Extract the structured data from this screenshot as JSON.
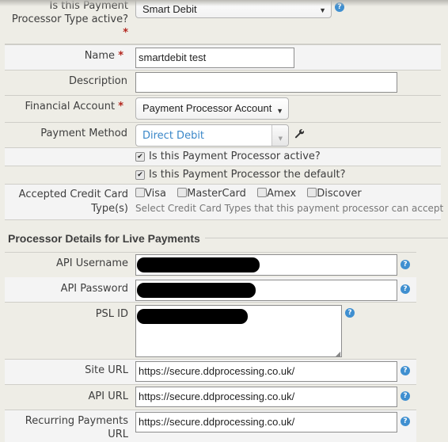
{
  "form": {
    "processor_type": {
      "label": "Is this Payment Processor Type active?",
      "label_line1": "Is this Payment",
      "label_line2": "Processor Type active?",
      "required": "*",
      "value": "Smart Debit",
      "arrow": "▼",
      "help": "?"
    },
    "name": {
      "label": "Name",
      "required": "*",
      "value": "smartdebit test"
    },
    "description": {
      "label": "Description",
      "value": ""
    },
    "financial_account": {
      "label": "Financial Account",
      "required": "*",
      "value": "Payment Processor Account",
      "arrow": "▼"
    },
    "payment_method": {
      "label": "Payment Method",
      "value": "Direct Debit",
      "arrow": "▼",
      "value_color": "#3a87c8",
      "edit_icon": "wrench-icon"
    },
    "active": {
      "label": "Is this Payment Processor active?",
      "checked": true
    },
    "default": {
      "label": "Is this Payment Processor the default?",
      "checked": true
    },
    "credit_cards": {
      "label_line1": "Accepted Credit Card",
      "label_line2": "Type(s)",
      "options": [
        {
          "label": "Visa",
          "checked": false
        },
        {
          "label": "MasterCard",
          "checked": false
        },
        {
          "label": "Amex",
          "checked": false
        },
        {
          "label": "Discover",
          "checked": false
        }
      ],
      "hint": "Select Credit Card Types that this payment processor can accept"
    }
  },
  "live_section": {
    "title": "Processor Details for Live Payments",
    "api_username": {
      "label": "API Username",
      "value": "[redacted]",
      "help": "?"
    },
    "api_password": {
      "label": "API Password",
      "value": "[redacted]",
      "help": "?"
    },
    "psl_id": {
      "label": "PSL ID",
      "value": "[redacted]",
      "help": "?"
    },
    "site_url": {
      "label": "Site URL",
      "value": "https://secure.ddprocessing.co.uk/",
      "help": "?"
    },
    "api_url": {
      "label": "API URL",
      "value": "https://secure.ddprocessing.co.uk/",
      "help": "?"
    },
    "recurring_url": {
      "label_line1": "Recurring Payments",
      "label_line2": "URL",
      "value": "https://secure.ddprocessing.co.uk/",
      "help": "?"
    }
  },
  "colors": {
    "required": "#b3261e",
    "help": "#3f8fd0",
    "link": "#3a87c8"
  }
}
